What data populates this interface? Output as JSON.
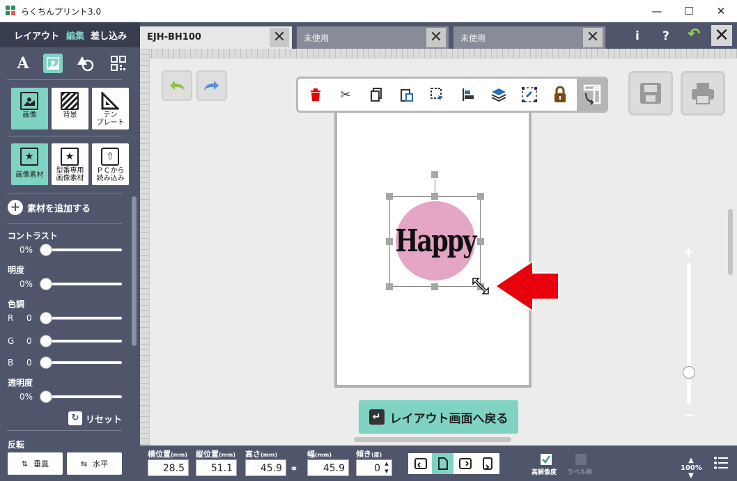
{
  "window": {
    "title": "らくちんプリント3.0",
    "min_glyph": "—",
    "max_glyph": "☐",
    "close_glyph": "✕"
  },
  "mode_tabs": [
    "レイアウト",
    "編集",
    "差し込み"
  ],
  "active_mode": "編集",
  "categories": [
    "text-icon",
    "image-icon",
    "shapes-icon",
    "qr-icon"
  ],
  "tiles_row1": [
    {
      "label": "画像",
      "icon": "image-icon",
      "active": true
    },
    {
      "label": "背景",
      "icon": "stripes-icon",
      "active": false
    },
    {
      "label": "テン\nプレート",
      "icon": "triangle-ruler-icon",
      "active": false
    }
  ],
  "tiles_row2": [
    {
      "label": "画像素材",
      "icon": "star-frame-icon",
      "active": true
    },
    {
      "label": "型番専用\n画像素材",
      "icon": "star-frame-icon",
      "active": false
    },
    {
      "label": "ＰＣから\n読み込み",
      "icon": "pc-upload-icon",
      "active": false
    }
  ],
  "add_material_label": "素材を追加する",
  "adjust": {
    "contrast": {
      "label": "コントラスト",
      "value": "0%"
    },
    "brightness": {
      "label": "明度",
      "value": "0%"
    },
    "tone": {
      "label": "色調",
      "r_label": "R",
      "r_value": "0",
      "g_label": "G",
      "g_value": "0",
      "b_label": "B",
      "b_value": "0"
    },
    "transparency": {
      "label": "透明度",
      "value": "0%"
    }
  },
  "reset_label": "リセット",
  "flip": {
    "label": "反転",
    "vertical": "垂直",
    "horizontal": "水平"
  },
  "doc_tabs": [
    {
      "label": "EJH-BH100",
      "active": true
    },
    {
      "label": "未使用",
      "active": false
    },
    {
      "label": "未使用",
      "active": false
    }
  ],
  "header_buttons": {
    "info": "i",
    "help": "?",
    "undo": "↶",
    "close": "✕"
  },
  "canvas": {
    "text": "Happy",
    "circle_color": "#e4a6c4",
    "back_button": "レイアウト画面へ戻る"
  },
  "toolbar_icons": [
    "delete-icon",
    "cut-icon",
    "copy-icon",
    "paste-icon",
    "select-icon",
    "align-icon",
    "layers-icon",
    "group-icon",
    "lock-icon",
    "mirror-icon"
  ],
  "position": {
    "x_label": "横位置",
    "x_unit": "(mm)",
    "x": "28.5",
    "y_label": "縦位置",
    "y_unit": "(mm)",
    "y": "51.1",
    "h_label": "高さ",
    "h_unit": "(mm)",
    "h": "45.9",
    "w_label": "幅",
    "w_unit": "(mm)",
    "w": "45.9",
    "angle_label": "傾き",
    "angle_unit": "(度)",
    "angle": "0"
  },
  "high_res_label": "高解像度",
  "label_frame_label": "ラベル枠",
  "zoom": {
    "level": "100%",
    "slider_fraction": 0.25
  },
  "colors": {
    "accent": "#7fd3c3",
    "panel": "#4f566c",
    "red": "#e8000c"
  }
}
